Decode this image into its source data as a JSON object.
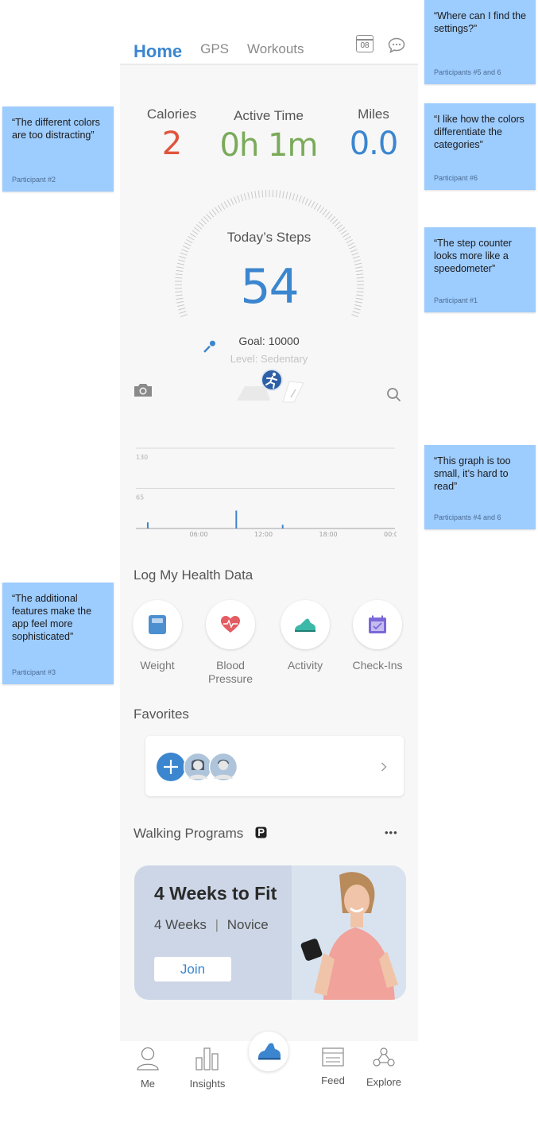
{
  "tabs": {
    "home": "Home",
    "gps": "GPS",
    "workouts": "Workouts"
  },
  "calendar_day": "08",
  "stats": {
    "calories_label": "Calories",
    "calories_value": "2",
    "active_label": "Active Time",
    "active_value": "0h 1m",
    "miles_label": "Miles",
    "miles_value": "0.0"
  },
  "steps": {
    "title": "Today’s Steps",
    "value": "54",
    "goal": "Goal: 10000",
    "level": "Level: Sedentary"
  },
  "chart_data": {
    "type": "bar",
    "y_ticks": [
      "130",
      "65"
    ],
    "x_ticks": [
      "06:00",
      "12:00",
      "18:00",
      "00:00"
    ],
    "ylim": [
      0,
      130
    ],
    "bars": [
      {
        "time_hour": 1.1,
        "value": 10
      },
      {
        "time_hour": 9.3,
        "value": 29
      },
      {
        "time_hour": 13.6,
        "value": 6
      }
    ]
  },
  "health": {
    "title": "Log My Health Data",
    "items": [
      {
        "label": "Weight"
      },
      {
        "label": "Blood\nPressure"
      },
      {
        "label": "Activity"
      },
      {
        "label": "Check-Ins"
      }
    ]
  },
  "favorites": {
    "title": "Favorites"
  },
  "walking": {
    "title": "Walking Programs",
    "more": "•••"
  },
  "program": {
    "title": "4 Weeks to Fit",
    "weeks": "4 Weeks",
    "sep": "|",
    "level": "Novice",
    "join": "Join"
  },
  "nav": {
    "me": "Me",
    "insights": "Insights",
    "feed": "Feed",
    "explore": "Explore"
  },
  "notes": {
    "settings": {
      "quote": "“Where can I find the settings?”",
      "who": "Participants #5 and 6"
    },
    "distracting": {
      "quote": "“The different colors are too distracting”",
      "who": "Participant #2"
    },
    "colors": {
      "quote": "“I like how the colors differentiate the categories”",
      "who": "Participant #6"
    },
    "speedometer": {
      "quote": "“The step counter looks more like a speedometer”",
      "who": "Participant #1"
    },
    "graph": {
      "quote": "“This graph is too small, it’s hard to read”",
      "who": "Participants #4 and 6"
    },
    "features": {
      "quote": "“The additional features make the app feel more sophisticated”",
      "who": "Participant #3"
    }
  },
  "colors": {
    "accent": "#3b86cf",
    "calories": "#e0543b",
    "active": "#7aaa5a",
    "miles": "#3b86cf",
    "note": "#9dccff"
  }
}
